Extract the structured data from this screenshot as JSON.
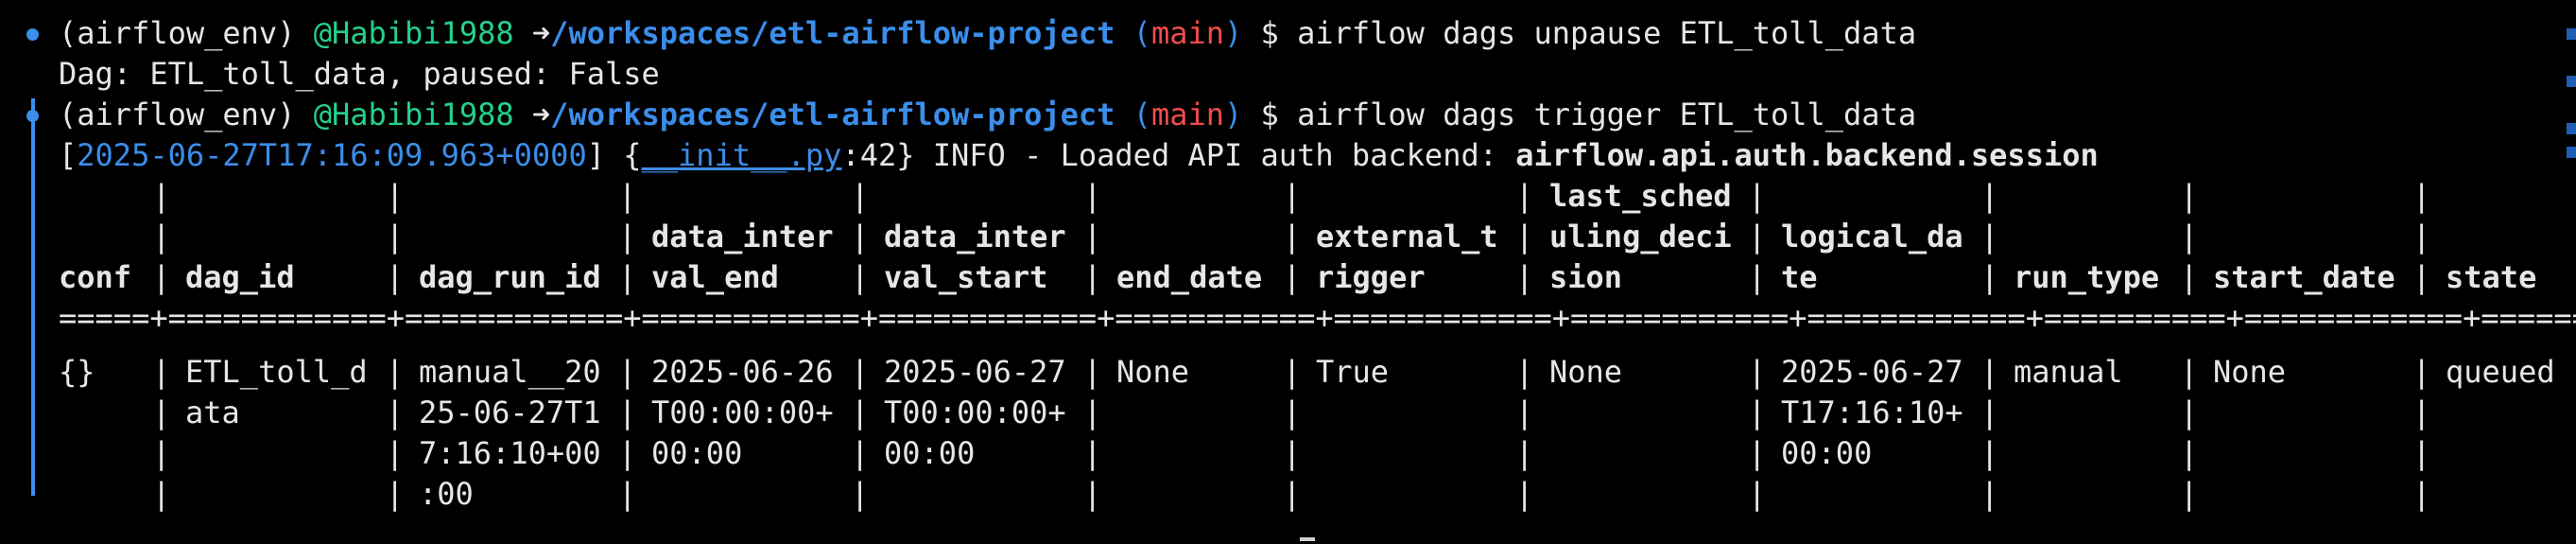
{
  "prompt": {
    "env": "(airflow_env)",
    "user": "@Habibi1988",
    "arrow": "➜",
    "path": "/workspaces/etl-airflow-project",
    "branch_open": "(",
    "branch": "main",
    "branch_close": ")",
    "dollar": "$"
  },
  "commands": [
    {
      "text": "airflow dags unpause ETL_toll_data"
    },
    {
      "text": "airflow dags trigger ETL_toll_data"
    }
  ],
  "output_unpause": "Dag: ETL_toll_data, paused: False",
  "log": {
    "open_bracket": "[",
    "timestamp": "2025-06-27T17:16:09.963+0000",
    "close_bracket": "]",
    "brace_open": "{",
    "file": "__init__.py",
    "line_no": ":42}",
    "message": "INFO - Loaded API auth backend: ",
    "backend": "airflow.api.auth.backend.session"
  },
  "table": {
    "header_rows": [
      [
        "",
        "",
        "",
        "",
        "",
        "",
        "",
        "last_sched",
        "",
        "",
        "",
        ""
      ],
      [
        "",
        "",
        "",
        "data_inter",
        "data_inter",
        "",
        "external_t",
        "uling_deci",
        "logical_da",
        "",
        "",
        ""
      ],
      [
        "conf",
        "dag_id",
        "dag_run_id",
        "val_end",
        "val_start",
        "end_date",
        "rigger",
        "sion",
        "te",
        "run_type",
        "start_date",
        "state"
      ]
    ],
    "separator": "=====+============+============+============+============+===========+============+============+============+==========+============+========",
    "body_rows": [
      [
        "{}",
        "ETL_toll_d",
        "manual__20",
        "2025-06-26",
        "2025-06-27",
        "None",
        "True",
        "None",
        "2025-06-27",
        "manual",
        "None",
        "queued"
      ],
      [
        "",
        "ata",
        "25-06-27T1",
        "T00:00:00+",
        "T00:00:00+",
        "",
        "",
        "",
        "T17:16:10+",
        "",
        "",
        ""
      ],
      [
        "",
        "",
        "7:16:10+00",
        "00:00",
        "00:00",
        "",
        "",
        "",
        "00:00",
        "",
        "",
        ""
      ],
      [
        "",
        "",
        ":00",
        "",
        "",
        "",
        "",
        "",
        "",
        "",
        "",
        ""
      ]
    ]
  },
  "colors": {
    "background": "#000000",
    "foreground": "#e6e6e6",
    "user": "#23d18b",
    "path": "#3b8eea",
    "branch": "#f14c4c"
  }
}
